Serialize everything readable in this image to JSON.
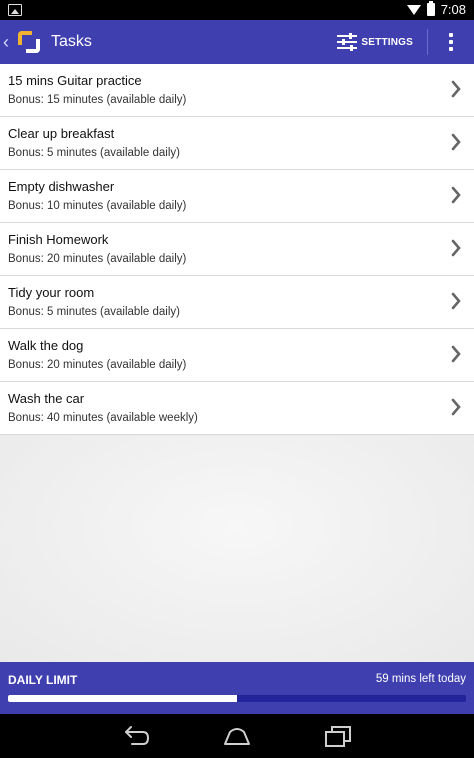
{
  "status_bar": {
    "time": "7:08",
    "icons": [
      "image-notification-icon",
      "wifi-icon",
      "battery-icon"
    ]
  },
  "action_bar": {
    "back_icon": "chevron-left-icon",
    "logo_icon": "app-logo-icon",
    "title": "Tasks",
    "settings_label": "SETTINGS",
    "settings_icon": "sliders-icon",
    "overflow_icon": "more-vert-icon",
    "color": "#3f3fb0"
  },
  "tasks": [
    {
      "name": "15 mins Guitar practice",
      "bonus": "Bonus: 15 minutes (available daily)"
    },
    {
      "name": "Clear up breakfast",
      "bonus": "Bonus: 5 minutes (available daily)"
    },
    {
      "name": "Empty dishwasher",
      "bonus": "Bonus: 10 minutes (available daily)"
    },
    {
      "name": "Finish Homework",
      "bonus": "Bonus: 20 minutes (available daily)"
    },
    {
      "name": "Tidy your room",
      "bonus": "Bonus: 5 minutes (available daily)"
    },
    {
      "name": "Walk the dog",
      "bonus": "Bonus: 20 minutes (available daily)"
    },
    {
      "name": "Wash the car",
      "bonus": "Bonus: 40 minutes (available weekly)"
    }
  ],
  "daily_limit": {
    "label": "DAILY LIMIT",
    "remaining": "59 mins left today",
    "progress_fraction": 0.5
  },
  "nav_bar": {
    "buttons": [
      "back-icon",
      "home-icon",
      "recents-icon"
    ]
  }
}
